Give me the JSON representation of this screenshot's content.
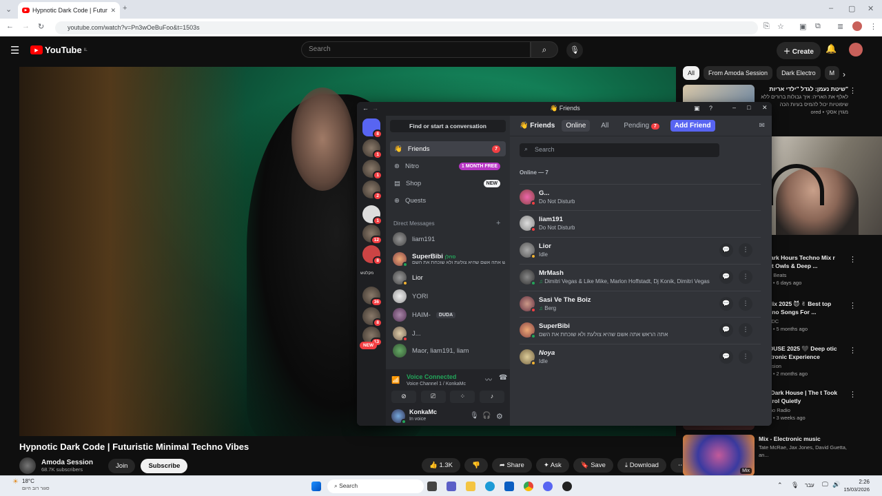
{
  "browser": {
    "tab_title": "Hypnotic Dark Code | Futur",
    "url": "youtube.com/watch?v=Pn3wOeBuFoo&t=1503s"
  },
  "youtube": {
    "logo_text": "YouTube",
    "logo_sup": "IL",
    "search_placeholder": "Search",
    "create_label": "Create",
    "video_title": "Hypnotic Dark Code | Futuristic Minimal Techno Vibes",
    "channel_name": "Amoda Session",
    "subscribers": "68.7K subscribers",
    "join_label": "Join",
    "subscribe_label": "Subscribe",
    "likes": "1.3K",
    "share_label": "Share",
    "ask_label": "Ask",
    "save_label": "Save",
    "download_label": "Download",
    "chips": [
      "All",
      "From Amoda Session",
      "Dark Electro",
      "M"
    ],
    "sidebar": [
      {
        "title": "שיטת נעמן: לגדל \"ילדי אריות\"",
        "meta1": "לאלף את האריה: איך גבולות ברורים ללא",
        "meta2": "שיפוטיות יכול להמיס בעיות הכה",
        "meta3": "ored • מגזין אסקי"
      },
      {
        "title": "ur Dark Hours Techno Mix r Night Owls & Deep ...",
        "meta1": "Ritual Beats",
        "meta2": "views • 6 days ago"
      },
      {
        "title": "no Mix 2025 😈 ✌ Best top Techno Songs For ...",
        "meta1": "NO EDC",
        "meta2": "views • 5 months ago"
      },
      {
        "title": "K HOUSE 2025 🖤 Deep otic Electronic Experience",
        "meta1": "a Session",
        "meta2": "views • 2 months ago"
      },
      {
        "title": "otic Dark House | The t Took Control Quietly",
        "meta1": "Techno Radio",
        "meta2": "views • 3 weeks ago"
      },
      {
        "title": "Mix - Electronic music",
        "meta1": "Tate McRae, Jax Jones, David Guetta, an...",
        "meta2": "",
        "badge": "Mix"
      }
    ]
  },
  "discord": {
    "window_title": "Friends",
    "find_conversation": "Find or start a conversation",
    "nav": {
      "friends": "Friends",
      "friends_badge": "7",
      "nitro": "Nitro",
      "nitro_badge": "1 MONTH FREE",
      "shop": "Shop",
      "shop_badge": "NEW",
      "quests": "Quests"
    },
    "dm_header": "Direct Messages",
    "dms": [
      {
        "name": "liam191",
        "sub": ""
      },
      {
        "name": "SuperBibi",
        "tag": "סחלן",
        "sub": "אתה הראש אתה אשם שהיא צולעת ולא שוכחת את השם"
      },
      {
        "name": "Lior",
        "sub": ""
      },
      {
        "name": "YORI",
        "sub": ""
      },
      {
        "name": "HAIM-",
        "tag": "DUDA",
        "sub": ""
      },
      {
        "name": "J...",
        "sub": ""
      },
      {
        "name": "Maor, liam191, liam",
        "sub": ""
      }
    ],
    "guild_badges": [
      "8",
      "1",
      "1",
      "2",
      "1",
      "12",
      "8",
      "36",
      "8",
      "13"
    ],
    "guild_label": "מקלטש",
    "new_badge": "NEW",
    "voice": {
      "status": "Voice Connected",
      "channel": "Voice Channel 1 / KonkaMc"
    },
    "user": {
      "name": "KonkaMc",
      "status": "In voice"
    },
    "header": {
      "friends": "Friends",
      "online": "Online",
      "all": "All",
      "pending": "Pending",
      "pending_badge": "7",
      "add_friend": "Add Friend"
    },
    "search_placeholder": "Search",
    "online_header": "Online — 7",
    "friends": [
      {
        "name": "G...",
        "status": "Do Not Disturb",
        "color": "#f23f43"
      },
      {
        "name": "liam191",
        "status": "Do Not Disturb",
        "color": "#f23f43"
      },
      {
        "name": "Lior",
        "status": "Idle",
        "color": "#f0b232"
      },
      {
        "name": "MrMash",
        "status": "Dimitri Vegas & Like Mike, Marlon Hoffstadt, Dj Konik, Dimitri Vegas",
        "color": "#23a55a"
      },
      {
        "name": "Sasi Ve The Boiz",
        "status": "Berg",
        "color": "#f23f43"
      },
      {
        "name": "SuperBibi",
        "status": "אתה הראש אתה אשם שהיא צולעת ולא שוכחת את השם",
        "color": "#23a55a"
      },
      {
        "name": "Noya",
        "status": "Idle",
        "color": "#f0b232"
      }
    ]
  },
  "taskbar": {
    "weather_temp": "18°C",
    "weather_desc": "סגור רוב היום",
    "search_label": "Search",
    "lang": "עבר",
    "time": "2:26",
    "date": "15/03/2026"
  }
}
